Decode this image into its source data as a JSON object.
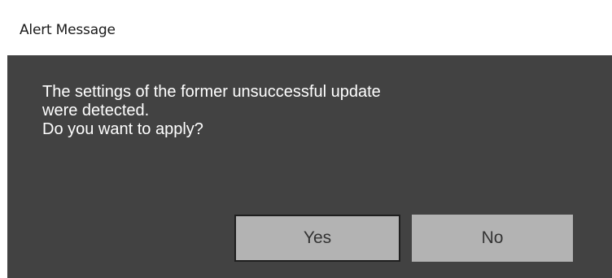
{
  "window": {
    "title": "Alert Message"
  },
  "dialog": {
    "message_lines": [
      "The settings of the former unsuccessful update",
      "were detected.",
      "Do you want to apply?"
    ],
    "buttons": {
      "yes_label": "Yes",
      "no_label": "No"
    }
  },
  "colors": {
    "dialog_background": "#424242",
    "message_text": "#ffffff",
    "button_background": "#b3b3b3",
    "button_text": "#333333",
    "focused_border": "#1f1f1f"
  }
}
